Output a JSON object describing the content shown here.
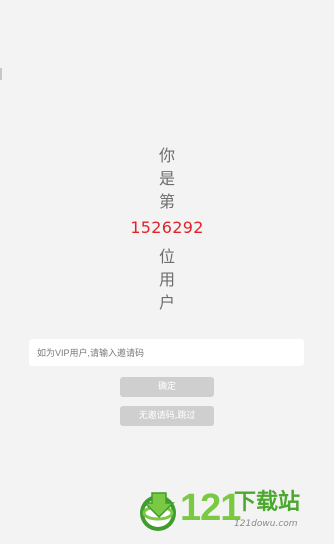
{
  "message": {
    "before": [
      "你",
      "是",
      "第"
    ],
    "count": "1526292",
    "after": [
      "位",
      "用",
      "户"
    ]
  },
  "invite": {
    "placeholder": "如为VIP用户,请输入邀请码",
    "value": ""
  },
  "buttons": {
    "confirm": "确定",
    "skip": "无邀请码,跳过"
  },
  "watermark": {
    "number": "121",
    "chinese": "下载站",
    "domain": "121dowu.com"
  },
  "colors": {
    "count": "#e1222a",
    "button_bg": "#cfcfcf",
    "logo_green": "#7ac943"
  }
}
